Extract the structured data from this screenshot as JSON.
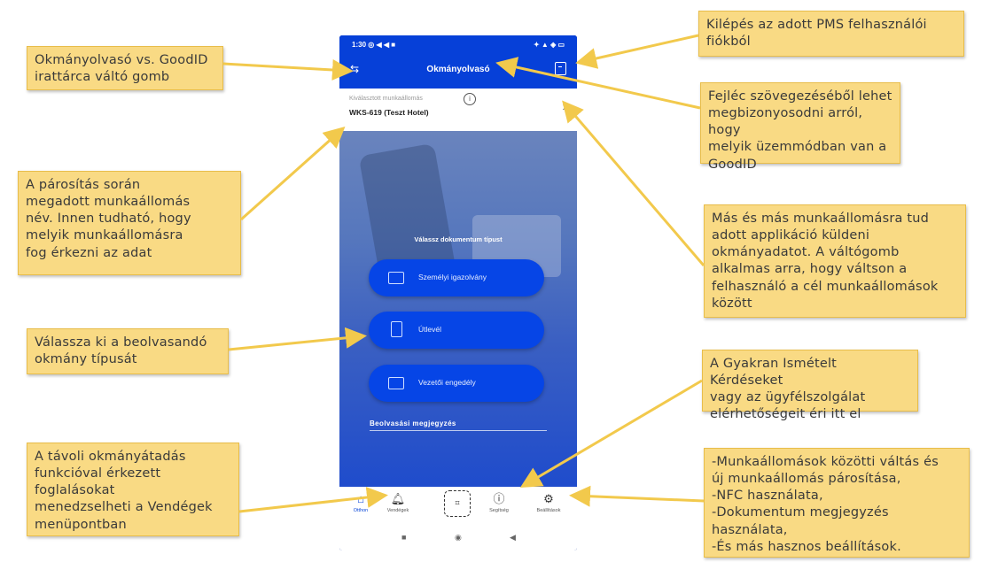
{
  "phone": {
    "status": {
      "time": "1:30 ◎ ◀ ◀ ■",
      "right": "✦ ▲ ◈ ▭"
    },
    "appbar": {
      "title": "Okmányolvasó",
      "swap_icon": "swap-icon",
      "logout_icon": "logout-icon"
    },
    "workstation": {
      "label": "Kiválasztott munkaállomás",
      "value": "WKS-619 (Teszt Hotel)",
      "info_icon": "info-icon",
      "chevron_icon": "chevron-right-icon"
    },
    "choose_label": "Válassz dokumentum típust",
    "doc_buttons": [
      {
        "label": "Személyi igazolvány",
        "icon": "id-card-icon"
      },
      {
        "label": "Útlevél",
        "icon": "passport-icon"
      },
      {
        "label": "Vezetői engedély",
        "icon": "driver-license-icon"
      }
    ],
    "notes_label": "Beolvasási megjegyzés",
    "nav": [
      {
        "label": "Otthon",
        "icon": "home-icon",
        "active": true
      },
      {
        "label": "Vendégek",
        "icon": "bell-icon"
      },
      {
        "label": "",
        "icon": "scan-icon"
      },
      {
        "label": "Segítség",
        "icon": "help-icon"
      },
      {
        "label": "Beállítások",
        "icon": "settings-icon"
      }
    ]
  },
  "annotations": {
    "switch_button": "Okmányolvasó vs. GoodID\nirattárca váltó gomb",
    "workstation_name": "A párosítás során\nmegadott munkaállomás\nnév. Innen tudható, hogy\nmelyik munkaállomásra\nfog érkezni az adat",
    "doc_type": "Válassza ki a beolvasandó\nokmány típusát",
    "remote_transfer": "A távoli okmányátadás\nfunkcióval érkezett\nfoglalásokat\nmenedzselheti a Vendégek\nmenüpontban",
    "logout": "Kilépés az adott PMS felhasználói\nfiókból",
    "header_mode": "Fejléc szövegezéséből lehet\nmegbizonyosodni arról, hogy\nmelyik üzemmódban van a\nGoodID",
    "workstation_switch": "Más és más munkaállomásra tud\nadott applikáció küldeni\nokmányadatot. A váltógomb\nalkalmas arra, hogy váltson a\nfelhasználó a cél munkaállomások\nközött",
    "faq": "A Gyakran Ismételt Kérdéseket\nvagy az ügyfélszolgálat\nelérhetőségeit éri itt el",
    "settings": "-Munkaállomások közötti váltás és\núj munkaállomás párosítása,\n-NFC használata,\n-Dokumentum megjegyzés\nhasználata,\n-És más hasznos beállítások."
  },
  "colors": {
    "primary_blue": "#0640d8",
    "note_yellow": "#f9da84",
    "arrow_yellow": "#f2c94c"
  }
}
